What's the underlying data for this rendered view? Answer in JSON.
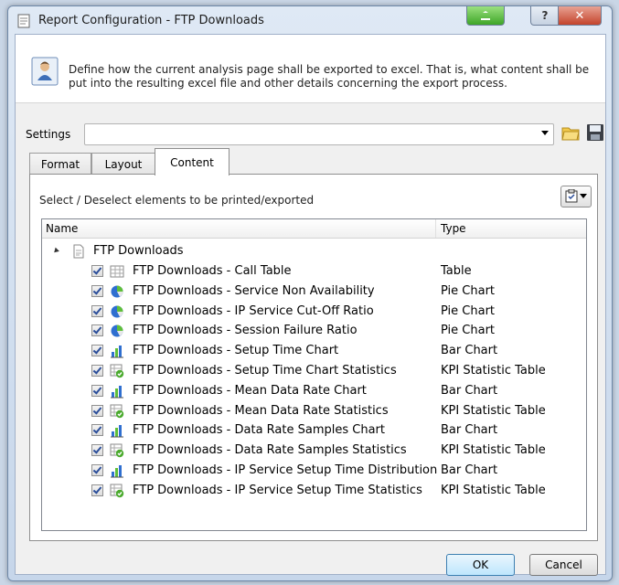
{
  "window": {
    "title": "Report Configuration - FTP Downloads"
  },
  "header": {
    "text": "Define how the current analysis page shall be exported to excel. That is, what content shall be put into the resulting excel file and other details concerning the export process."
  },
  "settings": {
    "label": "Settings",
    "value": ""
  },
  "tabs": [
    {
      "label": "Format"
    },
    {
      "label": "Layout"
    },
    {
      "label": "Content",
      "selected": true
    }
  ],
  "content": {
    "instruction": "Select / Deselect elements to be printed/exported",
    "columns": {
      "name": "Name",
      "type": "Type"
    },
    "root": {
      "label": "FTP Downloads"
    },
    "items": [
      {
        "name": "FTP Downloads - Call Table",
        "type": "Table",
        "icon": "table-icon",
        "checked": true
      },
      {
        "name": "FTP Downloads - Service Non Availability",
        "type": "Pie Chart",
        "icon": "pie-chart-icon",
        "checked": true
      },
      {
        "name": "FTP Downloads - IP Service Cut-Off Ratio",
        "type": "Pie Chart",
        "icon": "pie-chart-icon",
        "checked": true
      },
      {
        "name": "FTP Downloads - Session Failure Ratio",
        "type": "Pie Chart",
        "icon": "pie-chart-icon",
        "checked": true
      },
      {
        "name": "FTP Downloads - Setup Time Chart",
        "type": "Bar Chart",
        "icon": "bar-chart-icon",
        "checked": true
      },
      {
        "name": "FTP Downloads - Setup Time Chart Statistics",
        "type": "KPI Statistic Table",
        "icon": "kpi-table-icon",
        "checked": true
      },
      {
        "name": "FTP Downloads - Mean Data Rate Chart",
        "type": "Bar Chart",
        "icon": "bar-chart-icon",
        "checked": true
      },
      {
        "name": "FTP Downloads - Mean Data Rate Statistics",
        "type": "KPI Statistic Table",
        "icon": "kpi-table-icon",
        "checked": true
      },
      {
        "name": "FTP Downloads - Data Rate Samples Chart",
        "type": "Bar Chart",
        "icon": "bar-chart-icon",
        "checked": true
      },
      {
        "name": "FTP Downloads - Data Rate Samples Statistics",
        "type": "KPI Statistic Table",
        "icon": "kpi-table-icon",
        "checked": true
      },
      {
        "name": "FTP Downloads - IP Service Setup Time Distribution",
        "type": "Bar Chart",
        "icon": "bar-chart-icon",
        "checked": true
      },
      {
        "name": "FTP Downloads - IP Service Setup Time Statistics",
        "type": "KPI Statistic Table",
        "icon": "kpi-table-icon",
        "checked": true
      }
    ]
  },
  "buttons": {
    "ok": "OK",
    "cancel": "Cancel"
  }
}
